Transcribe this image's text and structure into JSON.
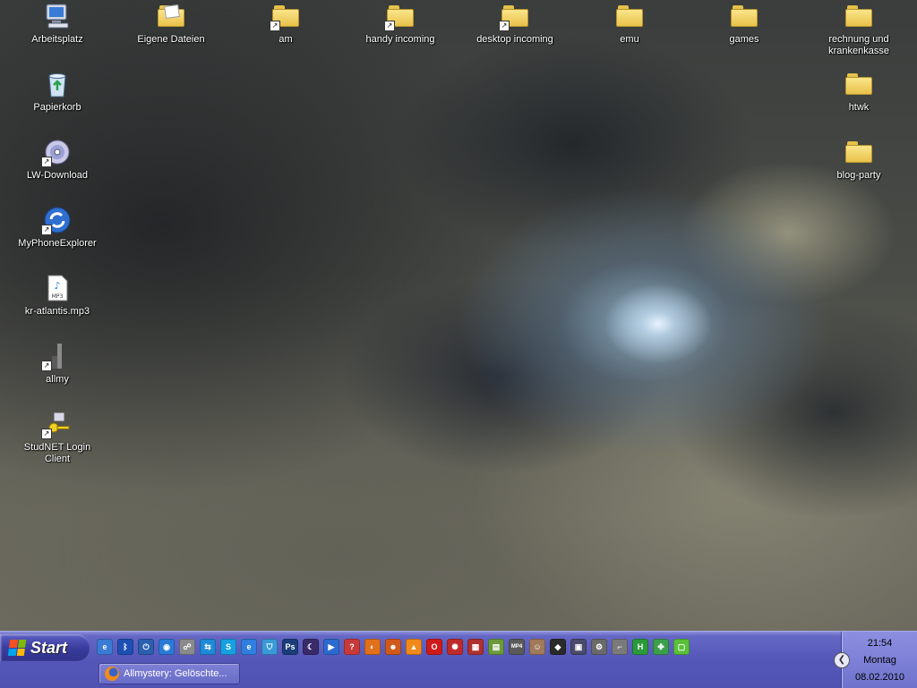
{
  "desktop": {
    "left_icons": [
      {
        "label": "Arbeitsplatz",
        "icon": "computer-icon"
      },
      {
        "label": "Papierkorb",
        "icon": "recycle-bin-icon"
      },
      {
        "label": "LW-Download",
        "icon": "cd-drive-shortcut-icon"
      },
      {
        "label": "MyPhoneExplorer",
        "icon": "sync-app-shortcut-icon"
      },
      {
        "label": "kr-atlantis.mp3",
        "icon": "mp3-file-icon"
      },
      {
        "label": "allmy",
        "icon": "app-shortcut-icon"
      },
      {
        "label": "StudNET Login Client",
        "icon": "key-shortcut-icon"
      }
    ],
    "top_icons": [
      {
        "label": "Eigene Dateien",
        "icon": "my-documents-folder-icon"
      },
      {
        "label": "am",
        "icon": "folder-shortcut-icon"
      },
      {
        "label": "handy incoming",
        "icon": "folder-shortcut-icon"
      },
      {
        "label": "desktop incoming",
        "icon": "folder-shortcut-icon"
      },
      {
        "label": "emu",
        "icon": "folder-icon"
      },
      {
        "label": "games",
        "icon": "folder-icon"
      },
      {
        "label": "rechnung und krankenkasse",
        "icon": "folder-icon"
      }
    ],
    "right_icons": [
      {
        "label": "htwk",
        "icon": "folder-icon"
      },
      {
        "label": "blog-party",
        "icon": "folder-icon"
      }
    ]
  },
  "taskbar": {
    "start_label": "Start",
    "quick_launch": [
      {
        "icon": "ie-settings-icon",
        "color": "#3a7bd5",
        "glyph": "e"
      },
      {
        "icon": "bluetooth-icon",
        "color": "#1e4fb4",
        "glyph": "ᛒ"
      },
      {
        "icon": "power-icon",
        "color": "#2b5fb0",
        "glyph": "⏻"
      },
      {
        "icon": "globe-icon",
        "color": "#2a7ad6",
        "glyph": "◉"
      },
      {
        "icon": "network-icon",
        "color": "#8a8a8a",
        "glyph": "☍"
      },
      {
        "icon": "teamviewer-icon",
        "color": "#1e8ad8",
        "glyph": "⇆"
      },
      {
        "icon": "skype-icon",
        "color": "#16a0e0",
        "glyph": "S"
      },
      {
        "icon": "internet-explorer-icon",
        "color": "#2f7ee0",
        "glyph": "e"
      },
      {
        "icon": "shield-icon",
        "color": "#3a9ad8",
        "glyph": "⛉"
      },
      {
        "icon": "photoshop-icon",
        "color": "#1b3d7a",
        "glyph": "Ps"
      },
      {
        "icon": "media-icon",
        "color": "#3a2a6a",
        "glyph": "☾"
      },
      {
        "icon": "media-player-icon",
        "color": "#2b6ad0",
        "glyph": "▶"
      },
      {
        "icon": "app-icon",
        "color": "#c83a3a",
        "glyph": "?"
      },
      {
        "icon": "firefox-icon",
        "color": "#e0701a",
        "glyph": "◐"
      },
      {
        "icon": "app-icon",
        "color": "#d05a1a",
        "glyph": "☻"
      },
      {
        "icon": "vlc-icon",
        "color": "#f08a1a",
        "glyph": "▲"
      },
      {
        "icon": "opera-icon",
        "color": "#d01a1a",
        "glyph": "O"
      },
      {
        "icon": "app-icon",
        "color": "#c02a2a",
        "glyph": "✺"
      },
      {
        "icon": "app-icon",
        "color": "#b03030",
        "glyph": "▦"
      },
      {
        "icon": "app-icon",
        "color": "#6a9a3a",
        "glyph": "▤"
      },
      {
        "icon": "mp4-icon",
        "color": "#5a5a5a",
        "glyph": "MP4"
      },
      {
        "icon": "portrait-icon",
        "color": "#a07a5a",
        "glyph": "☺"
      },
      {
        "icon": "app-icon",
        "color": "#2a2a2a",
        "glyph": "◆"
      },
      {
        "icon": "app-icon",
        "color": "#4a4a6a",
        "glyph": "▣"
      },
      {
        "icon": "gear-icon",
        "color": "#6a6a6a",
        "glyph": "⚙"
      },
      {
        "icon": "gun-icon",
        "color": "#7a7a7a",
        "glyph": "⌐"
      },
      {
        "icon": "app-icon",
        "color": "#2a9a3a",
        "glyph": "H"
      },
      {
        "icon": "clover-icon",
        "color": "#3aa04a",
        "glyph": "✤"
      },
      {
        "icon": "app-icon",
        "color": "#5ac03a",
        "glyph": "▢"
      }
    ],
    "tasks": [
      {
        "label": "Allmystery: Gelöschte...",
        "icon": "firefox-icon"
      }
    ],
    "clock": {
      "time": "21:54",
      "day": "Montag",
      "date": "08.02.2010"
    }
  }
}
